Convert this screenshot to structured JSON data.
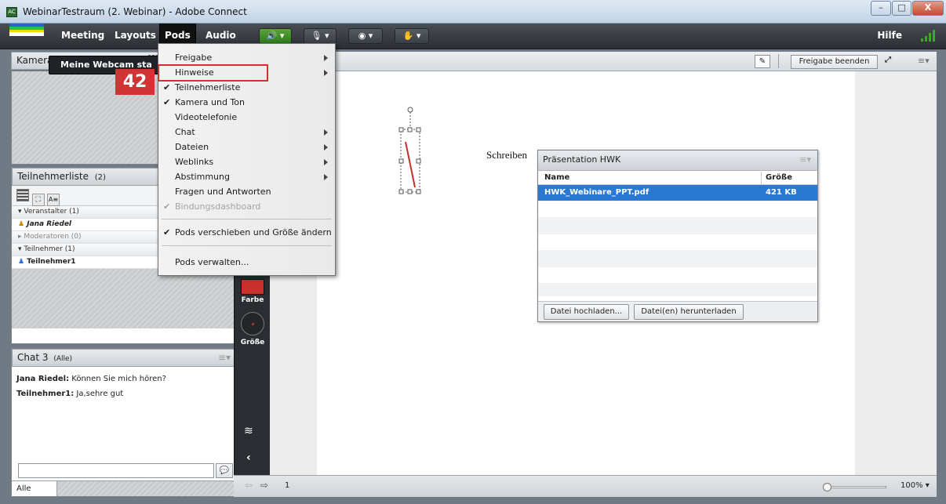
{
  "window": {
    "title": "WebinarTestraum (2. Webinar) - Adobe Connect",
    "app_icon": "AC"
  },
  "window_controls": {
    "minimize": "–",
    "maximize": "□",
    "close": "X"
  },
  "menubar": {
    "items": [
      "Meeting",
      "Layouts",
      "Pods",
      "Audio"
    ],
    "active": "Pods",
    "help": "Hilfe"
  },
  "pods_menu": {
    "items": [
      {
        "label": "Freigabe",
        "checked": false,
        "submenu": true
      },
      {
        "label": "Hinweise",
        "checked": false,
        "submenu": true
      },
      {
        "label": "Teilnehmerliste",
        "checked": true,
        "submenu": false
      },
      {
        "label": "Kamera und Ton",
        "checked": true,
        "submenu": false
      },
      {
        "label": "Videotelefonie",
        "checked": false,
        "submenu": false
      },
      {
        "label": "Chat",
        "checked": false,
        "submenu": true
      },
      {
        "label": "Dateien",
        "checked": false,
        "submenu": true
      },
      {
        "label": "Weblinks",
        "checked": false,
        "submenu": true
      },
      {
        "label": "Abstimmung",
        "checked": false,
        "submenu": true
      },
      {
        "label": "Fragen und Antworten",
        "checked": false,
        "submenu": false
      },
      {
        "label": "Bindungsdashboard",
        "checked": true,
        "submenu": false,
        "disabled": true
      },
      {
        "label": "Pods verschieben und Größe ändern",
        "checked": true,
        "submenu": false
      },
      {
        "label": "Pods verwalten...",
        "checked": false,
        "submenu": false
      }
    ]
  },
  "camera_pod": {
    "title": "Kamera und Ton",
    "webcam_button": "Meine Webcam sta",
    "badge": "42"
  },
  "attendees": {
    "title": "Teilnehmerliste",
    "count": "(2)",
    "groups": [
      {
        "label": "Veranstalter (1)",
        "members": [
          "Jana Riedel"
        ]
      },
      {
        "label": "Moderatoren (0)",
        "members": []
      },
      {
        "label": "Teilnehmer (1)",
        "members": [
          "Teilnehmer1"
        ]
      }
    ]
  },
  "chat": {
    "title": "Chat 3",
    "scope": "(Alle)",
    "messages": [
      {
        "author": "Jana Riedel:",
        "text": " Können Sie mich hören?"
      },
      {
        "author": "Teilnehmer1:",
        "text": " Ja,sehre gut"
      }
    ],
    "recipient": "Alle"
  },
  "tools": {
    "color_label": "Farbe",
    "size_label": "Größe",
    "color": "#c8302c"
  },
  "stage": {
    "stop_share": "Freigabe beenden",
    "canvas_text": "Schreiben",
    "page": "1",
    "zoom": "100%",
    "zoom_level": 0.05
  },
  "presentation_pod": {
    "title": "Präsentation HWK",
    "columns": [
      "Name",
      "Größe"
    ],
    "files": [
      {
        "name": "HWK_Webinare_PPT.pdf",
        "size": "421 KB"
      }
    ],
    "upload_button": "Datei hochladen...",
    "download_button": "Datei(en) herunterladen"
  },
  "colors": {
    "accent": "#2b78d4",
    "highlight": "#d33030",
    "menubar": "#33383d"
  }
}
